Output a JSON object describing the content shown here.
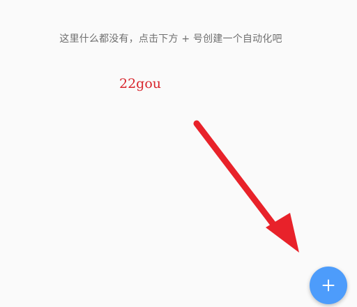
{
  "empty_state": {
    "message": "这里什么都没有，点击下方 + 号创建一个自动化吧"
  },
  "watermark": {
    "text": "22gou",
    "color": "#d8262d"
  },
  "annotation_arrow": {
    "color": "#e8222a"
  },
  "fab": {
    "icon": "plus-icon",
    "color": "#4d9cfb"
  }
}
